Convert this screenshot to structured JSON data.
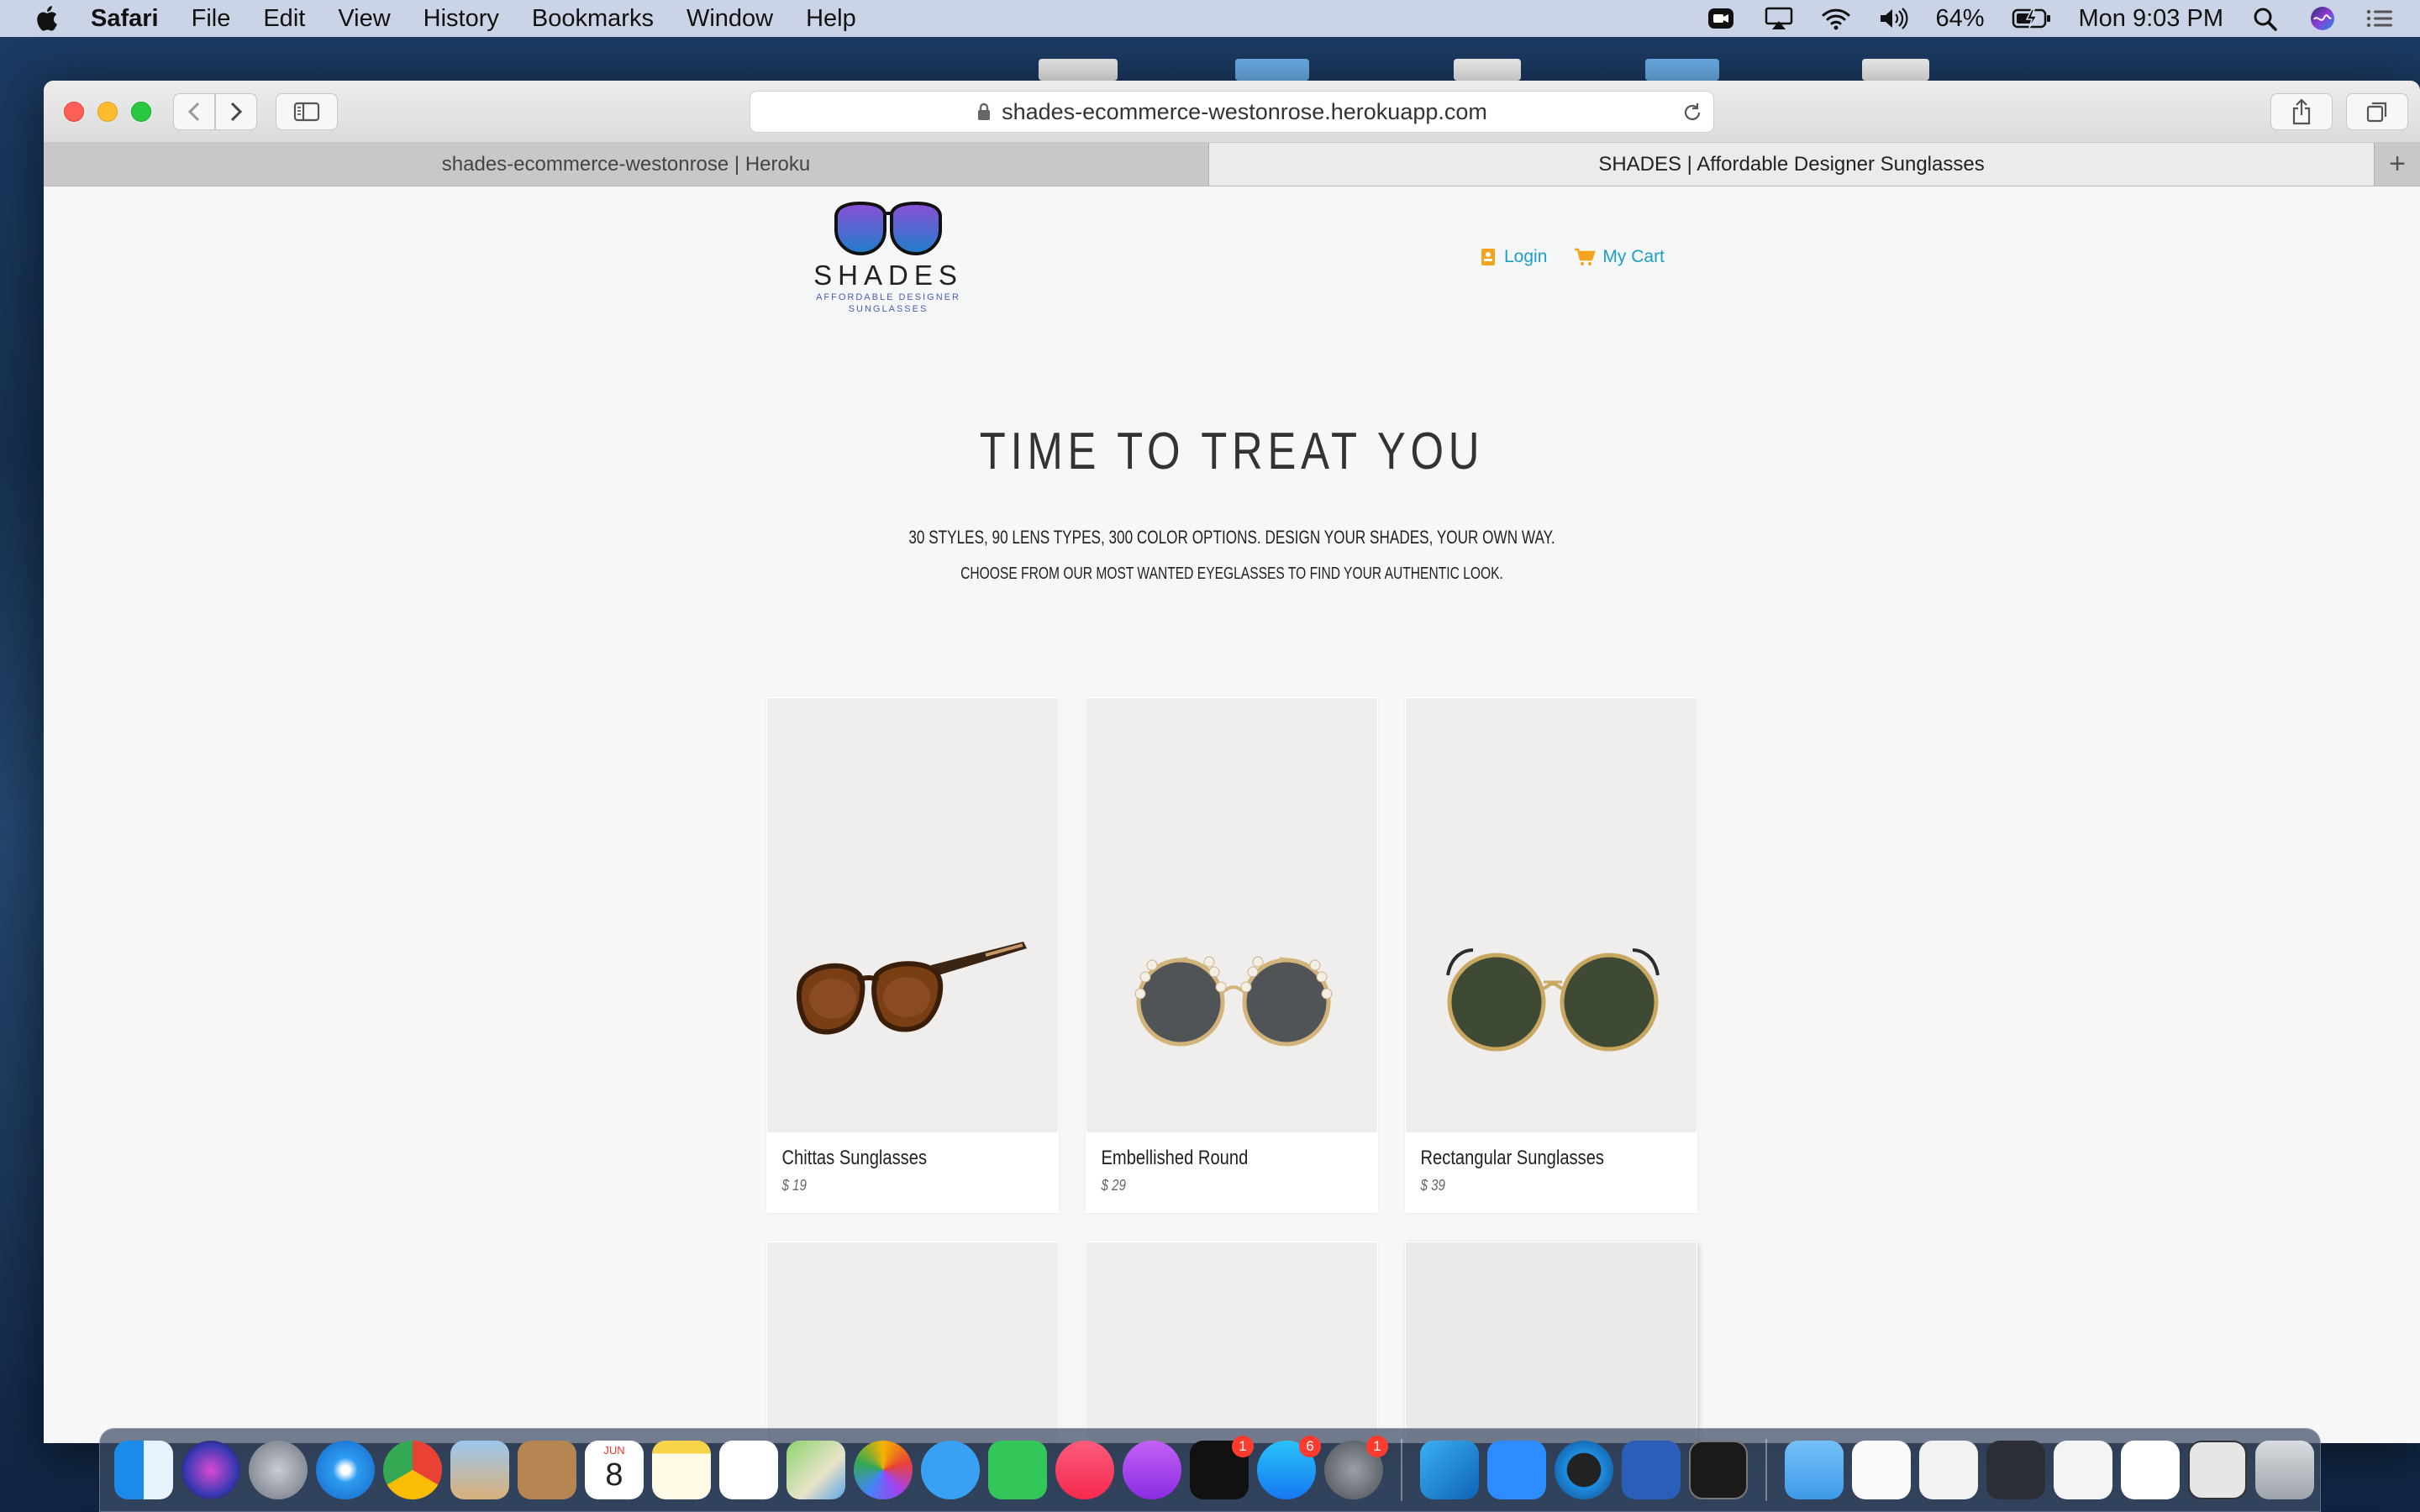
{
  "menubar": {
    "app_name": "Safari",
    "items": [
      "File",
      "Edit",
      "View",
      "History",
      "Bookmarks",
      "Window",
      "Help"
    ],
    "battery": "64%",
    "clock": "Mon 9:03 PM"
  },
  "browser": {
    "url": "shades-ecommerce-westonrose.herokuapp.com",
    "tabs": [
      {
        "label": "shades-ecommerce-westonrose | Heroku"
      },
      {
        "label": "SHADES | Affordable Designer Sunglasses"
      }
    ]
  },
  "site": {
    "brand": "SHADES",
    "tagline_1": "AFFORDABLE DESIGNER",
    "tagline_2": "SUNGLASSES",
    "login_label": "Login",
    "cart_label": "My Cart",
    "hero_title": "TIME TO TREAT YOU",
    "hero_sub_1": "30 STYLES, 90 LENS TYPES, 300 COLOR OPTIONS. DESIGN YOUR SHADES, YOUR OWN WAY.",
    "hero_sub_2": "CHOOSE FROM OUR MOST WANTED EYEGLASSES TO FIND YOUR AUTHENTIC LOOK.",
    "products": [
      {
        "name": "Chittas Sunglasses",
        "price": "$ 19",
        "frame": "#7a3e14",
        "lens": "#8a4a24"
      },
      {
        "name": "Embellished Round",
        "price": "$ 29",
        "frame": "#d2b37a",
        "lens": "#505457"
      },
      {
        "name": "Rectangular Sunglasses",
        "price": "$ 39",
        "frame": "#c8a860",
        "lens": "#3f4a34"
      }
    ]
  },
  "dock": {
    "calendar_month": "JUN",
    "calendar_day": "8",
    "badges": {
      "tv": "1",
      "appstore": "6",
      "settings": "1"
    }
  },
  "colors": {
    "accent_link": "#1a9fc5",
    "icon_orange": "#f3a41c"
  }
}
